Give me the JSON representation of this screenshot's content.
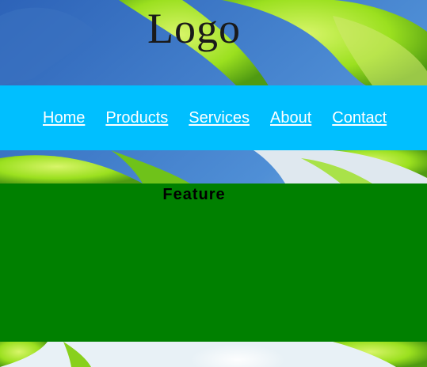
{
  "header": {
    "logo_text": "Logo"
  },
  "nav": {
    "items": [
      {
        "label": "Home"
      },
      {
        "label": "Products"
      },
      {
        "label": "Services"
      },
      {
        "label": "About"
      },
      {
        "label": "Contact"
      }
    ]
  },
  "feature": {
    "heading": "Feature"
  },
  "colors": {
    "nav_background": "#00bfff",
    "nav_link": "#ffffff",
    "feature_background": "#008000",
    "sky_blue": "#4a86c8",
    "leaf_green": "#9be01f"
  },
  "background": {
    "description_icon": "leaves-background-image"
  }
}
